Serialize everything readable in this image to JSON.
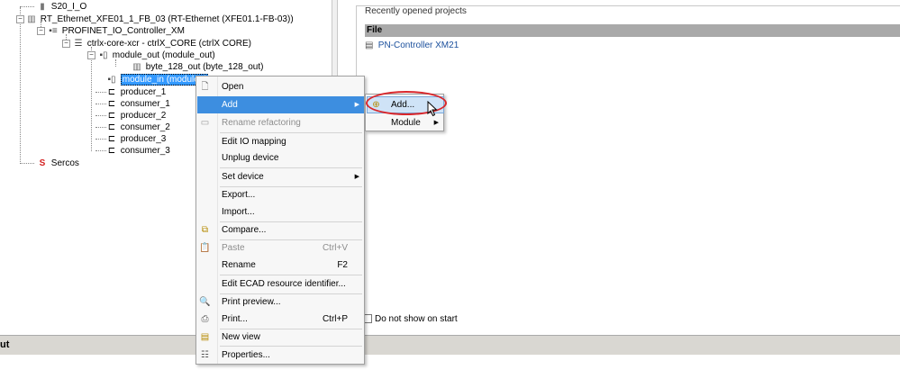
{
  "tree": {
    "items": [
      {
        "label": "S20_I_O",
        "icon": "io-module-icon"
      },
      {
        "label": "RT_Ethernet_XFE01_1_FB_03 (RT-Ethernet (XFE01.1-FB-03))",
        "icon": "ethernet-device-icon"
      },
      {
        "label": "PROFINET_IO_Controller_XM",
        "icon": "profinet-icon"
      },
      {
        "label": "ctrlx-core-xcr - ctrlX_CORE (ctrlX CORE)",
        "icon": "ctrlx-core-icon"
      },
      {
        "label": "module_out (module_out)",
        "icon": "module-icon"
      },
      {
        "label": "byte_128_out (byte_128_out)",
        "icon": "byte-icon"
      },
      {
        "label": "module_in (module_in)",
        "icon": "module-icon"
      },
      {
        "label": "producer_1",
        "icon": "producer-icon"
      },
      {
        "label": "consumer_1",
        "icon": "consumer-icon"
      },
      {
        "label": "producer_2",
        "icon": "producer-icon"
      },
      {
        "label": "consumer_2",
        "icon": "consumer-icon"
      },
      {
        "label": "producer_3",
        "icon": "producer-icon"
      },
      {
        "label": "consumer_3",
        "icon": "consumer-icon"
      },
      {
        "label": "Sercos",
        "icon": "sercos-icon"
      }
    ],
    "selected_display": "module_in (module_i",
    "sercos_glyph": "S"
  },
  "start_page": {
    "recent_title": "Recently opened projects",
    "file_header": "File",
    "recent_file": "PN-Controller XM21",
    "dont_show": "Do not show on start"
  },
  "bottom_bar": {
    "label": "ut"
  },
  "context_menu": {
    "items": [
      {
        "label": "Open",
        "shortcut": "",
        "icon": "document-icon"
      },
      {
        "label": "Add",
        "shortcut": "",
        "icon": ""
      },
      {
        "label": "Rename refactoring",
        "shortcut": "",
        "icon": "rename-icon"
      },
      {
        "label": "Edit IO mapping",
        "shortcut": "",
        "icon": ""
      },
      {
        "label": "Unplug device",
        "shortcut": "",
        "icon": ""
      },
      {
        "label": "Set device",
        "shortcut": "",
        "icon": ""
      },
      {
        "label": "Export...",
        "shortcut": "",
        "icon": ""
      },
      {
        "label": "Import...",
        "shortcut": "",
        "icon": ""
      },
      {
        "label": "Compare...",
        "shortcut": "",
        "icon": "compare-icon"
      },
      {
        "label": "Paste",
        "shortcut": "Ctrl+V",
        "icon": "paste-icon"
      },
      {
        "label": "Rename",
        "shortcut": "F2",
        "icon": ""
      },
      {
        "label": "Edit ECAD resource identifier...",
        "shortcut": "",
        "icon": ""
      },
      {
        "label": "Print preview...",
        "shortcut": "",
        "icon": "print-preview-icon"
      },
      {
        "label": "Print...",
        "shortcut": "Ctrl+P",
        "icon": "printer-icon"
      },
      {
        "label": "New view",
        "shortcut": "",
        "icon": "new-view-icon"
      },
      {
        "label": "Properties...",
        "shortcut": "",
        "icon": "properties-icon"
      }
    ]
  },
  "submenu": {
    "items": [
      {
        "label": "Add...",
        "icon": "add-device-icon"
      },
      {
        "label": "Module",
        "icon": ""
      }
    ]
  },
  "colors": {
    "selection": "#3399ff",
    "menu_hover": "#3d8ee0",
    "highlight_ring": "#d9262b",
    "link": "#1a4f9c"
  }
}
